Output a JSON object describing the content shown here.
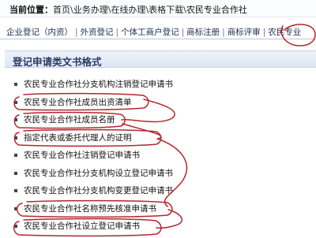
{
  "breadcrumb": {
    "label": "当前位置：",
    "items": [
      "首页",
      "业务办理",
      "在线办理",
      "表格下载",
      "农民专业合作社"
    ],
    "separator": "\\"
  },
  "tabs": [
    {
      "label": "企业登记（内资）"
    },
    {
      "label": "外资登记"
    },
    {
      "label": "个体工商户登记"
    },
    {
      "label": "商标注册"
    },
    {
      "label": "商标评审"
    },
    {
      "label": "农民专业"
    }
  ],
  "tab_separator": "|",
  "section": {
    "title": "登记申请类文书格式"
  },
  "documents": [
    {
      "label": "农民专业合作社分支机构注销登记申请书"
    },
    {
      "label": "农民专业合作社成员出资清单"
    },
    {
      "label": "农民专业合作社成员名册"
    },
    {
      "label": "指定代表或委托代理人的证明"
    },
    {
      "label": "农民专业合作社注销登记申请书"
    },
    {
      "label": "农民专业合作社分支机构设立登记申请书"
    },
    {
      "label": "农民专业合作社分支机构变更登记申请书"
    },
    {
      "label": "农民专业合作社名称预先核准申请书"
    },
    {
      "label": "农民专业合作社设立登记申请书"
    }
  ],
  "annotation_color": "#b3282d"
}
